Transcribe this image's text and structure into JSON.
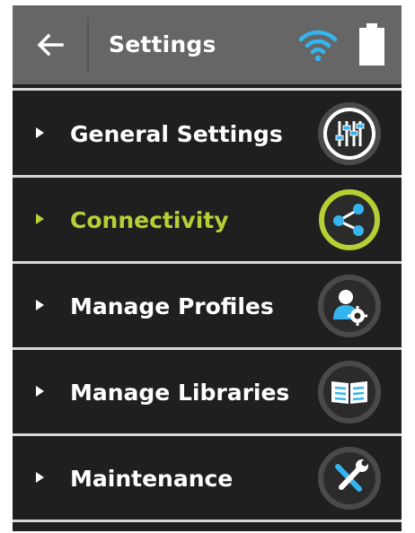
{
  "header": {
    "title": "Settings",
    "back_icon": "arrow-left-icon",
    "wifi_icon": "wifi-icon",
    "battery_icon": "battery-icon"
  },
  "colors": {
    "header_bg": "#666666",
    "panel_bg": "#1f1f1f",
    "accent": "#b7cf34",
    "wifi": "#35b5f0"
  },
  "menu": {
    "items": [
      {
        "label": "General Settings",
        "icon": "sliders-icon",
        "active": false
      },
      {
        "label": "Connectivity",
        "icon": "share-icon",
        "active": true
      },
      {
        "label": "Manage Profiles",
        "icon": "profile-settings-icon",
        "active": false
      },
      {
        "label": "Manage Libraries",
        "icon": "book-icon",
        "active": false
      },
      {
        "label": "Maintenance",
        "icon": "tools-icon",
        "active": false
      }
    ]
  }
}
